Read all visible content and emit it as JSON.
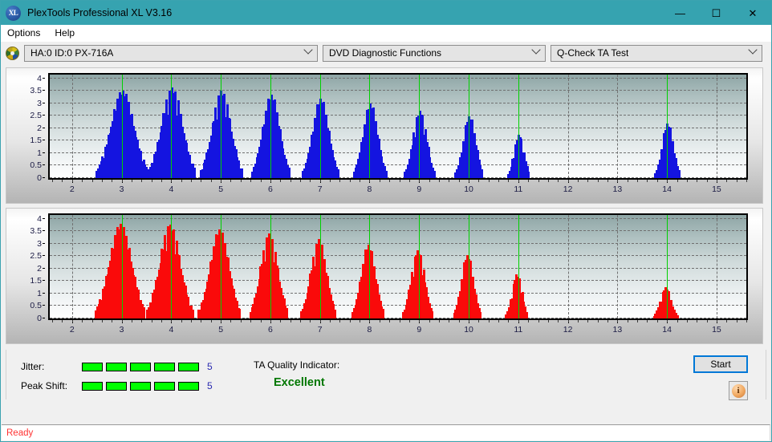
{
  "window": {
    "title": "PlexTools Professional XL V3.16",
    "app_icon": "xl-logo-icon",
    "minimize": "—",
    "maximize": "☐",
    "close": "✕"
  },
  "menu": {
    "items": [
      {
        "label": "Options"
      },
      {
        "label": "Help"
      }
    ]
  },
  "toolbar": {
    "disc_icon": "disc-icon",
    "drive_selector": "HA:0 ID:0  PX-716A",
    "function_selector": "DVD Diagnostic Functions",
    "test_selector": "Q-Check TA Test"
  },
  "bottom": {
    "jitter_label": "Jitter:",
    "jitter_value": "5",
    "jitter_blocks": 5,
    "peak_shift_label": "Peak Shift:",
    "peak_shift_value": "5",
    "peak_shift_blocks": 5,
    "ta_title": "TA Quality Indicator:",
    "ta_value": "Excellent",
    "ta_color": "#007700",
    "start_label": "Start",
    "info_label": "i"
  },
  "statusbar": {
    "text": "Ready"
  },
  "chart_data": [
    {
      "type": "bar",
      "title": "",
      "id": "jitter-chart",
      "color": "#1414e0",
      "xlabel": "",
      "ylabel": "",
      "xlim": [
        1.55,
        15.6
      ],
      "ylim": [
        0,
        4.15
      ],
      "xticks": [
        2,
        3,
        4,
        5,
        6,
        7,
        8,
        9,
        10,
        11,
        12,
        13,
        14,
        15
      ],
      "yticks": [
        0,
        0.5,
        1,
        1.5,
        2,
        2.5,
        3,
        3.5,
        4
      ],
      "grid": true,
      "markers": [
        3,
        4,
        5,
        6,
        7,
        8,
        9,
        10,
        11,
        14
      ],
      "marker_color": "#00d100",
      "clusters": [
        {
          "center": 3.02,
          "peak": 3.52,
          "halfwidth": 0.52
        },
        {
          "center": 4.02,
          "peak": 3.62,
          "halfwidth": 0.47
        },
        {
          "center": 5.02,
          "peak": 3.5,
          "halfwidth": 0.42
        },
        {
          "center": 6.02,
          "peak": 3.35,
          "halfwidth": 0.38
        },
        {
          "center": 7.02,
          "peak": 3.2,
          "halfwidth": 0.36
        },
        {
          "center": 8.02,
          "peak": 3.0,
          "halfwidth": 0.33
        },
        {
          "center": 9.02,
          "peak": 2.72,
          "halfwidth": 0.3
        },
        {
          "center": 10.02,
          "peak": 2.5,
          "halfwidth": 0.28
        },
        {
          "center": 11.02,
          "peak": 1.76,
          "halfwidth": 0.22
        },
        {
          "center": 14.02,
          "peak": 2.2,
          "halfwidth": 0.25
        }
      ]
    },
    {
      "type": "bar",
      "title": "",
      "id": "peak-shift-chart",
      "color": "#fa0a0a",
      "xlabel": "",
      "ylabel": "",
      "xlim": [
        1.55,
        15.6
      ],
      "ylim": [
        0,
        4.15
      ],
      "xticks": [
        2,
        3,
        4,
        5,
        6,
        7,
        8,
        9,
        10,
        11,
        12,
        13,
        14,
        15
      ],
      "yticks": [
        0,
        0.5,
        1,
        1.5,
        2,
        2.5,
        3,
        3.5,
        4
      ],
      "grid": true,
      "markers": [
        3,
        4,
        5,
        6,
        7,
        8,
        9,
        10,
        11,
        14
      ],
      "marker_color": "#00d100",
      "clusters": [
        {
          "center": 2.98,
          "peak": 3.8,
          "halfwidth": 0.5
        },
        {
          "center": 3.98,
          "peak": 3.78,
          "halfwidth": 0.46
        },
        {
          "center": 4.98,
          "peak": 3.58,
          "halfwidth": 0.42
        },
        {
          "center": 5.98,
          "peak": 3.4,
          "halfwidth": 0.38
        },
        {
          "center": 6.98,
          "peak": 3.18,
          "halfwidth": 0.35
        },
        {
          "center": 7.98,
          "peak": 2.95,
          "halfwidth": 0.32
        },
        {
          "center": 8.98,
          "peak": 2.75,
          "halfwidth": 0.3
        },
        {
          "center": 9.98,
          "peak": 2.55,
          "halfwidth": 0.27
        },
        {
          "center": 10.98,
          "peak": 1.78,
          "halfwidth": 0.22
        },
        {
          "center": 13.98,
          "peak": 1.25,
          "halfwidth": 0.24
        }
      ]
    }
  ]
}
